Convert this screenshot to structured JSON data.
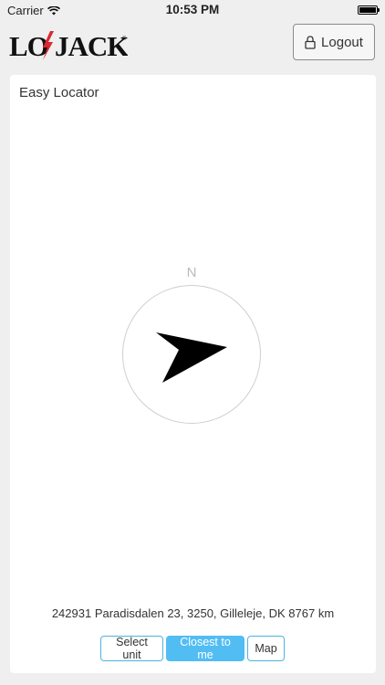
{
  "status_bar": {
    "carrier": "Carrier",
    "time": "10:53 PM"
  },
  "header": {
    "logo_text": "LO JACK",
    "logout_label": "Logout",
    "colors": {
      "logo_bolt": "#d9282f"
    }
  },
  "card": {
    "title": "Easy Locator",
    "compass": {
      "north_label": "N",
      "arrow_icon": "navigation-arrow-icon"
    },
    "location": "242931 Paradisdalen 23, 3250, Gilleleje, DK 8767 km"
  },
  "buttons": {
    "select_unit": "Select unit",
    "closest_to_me": "Closest to me",
    "map": "Map"
  },
  "colors": {
    "accent": "#51bdf3",
    "button_border": "#4cb4e0",
    "background": "#efefef"
  }
}
